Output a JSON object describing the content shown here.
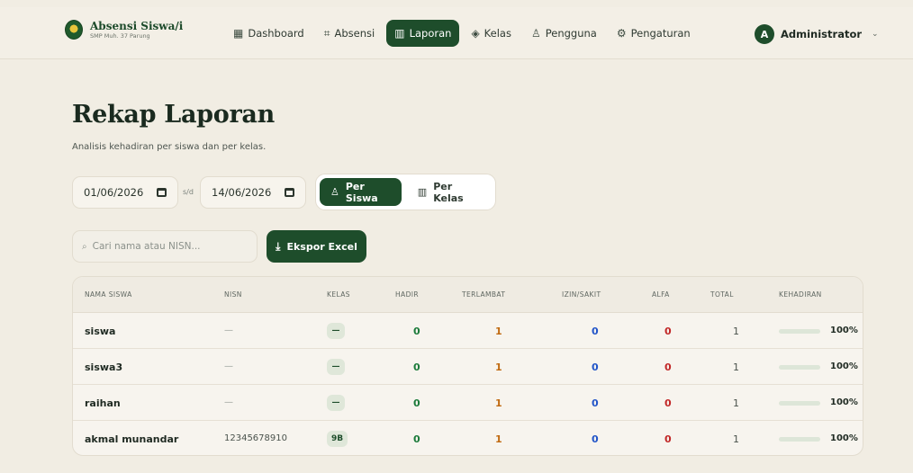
{
  "brand": {
    "title": "Absensi Siswa/i",
    "subtitle": "SMP Muh. 37 Parung"
  },
  "nav": [
    {
      "label": "Dashboard",
      "icon": "grid-icon",
      "glyph": "▦",
      "active": false
    },
    {
      "label": "Absensi",
      "icon": "scan-icon",
      "glyph": "⌗",
      "active": false
    },
    {
      "label": "Laporan",
      "icon": "bar-chart-icon",
      "glyph": "▥",
      "active": true
    },
    {
      "label": "Kelas",
      "icon": "graduation-cap-icon",
      "glyph": "◈",
      "active": false
    },
    {
      "label": "Pengguna",
      "icon": "users-icon",
      "glyph": "♙",
      "active": false
    },
    {
      "label": "Pengaturan",
      "icon": "gear-icon",
      "glyph": "⚙",
      "active": false
    }
  ],
  "user": {
    "initial": "A",
    "name": "Administrator"
  },
  "page": {
    "title": "Rekap Laporan",
    "subtitle": "Analisis kehadiran per siswa dan per kelas."
  },
  "filters": {
    "date_from": "01/06/2026",
    "date_to": "14/06/2026",
    "separator": "s/d",
    "modes": [
      {
        "label": "Per Siswa",
        "icon": "users-icon",
        "glyph": "♙",
        "active": true
      },
      {
        "label": "Per Kelas",
        "icon": "bar-chart-icon",
        "glyph": "▥",
        "active": false
      }
    ],
    "search_placeholder": "Cari nama atau NISN...",
    "export_label": "Ekspor Excel"
  },
  "table": {
    "headers": [
      "NAMA SISWA",
      "NISN",
      "KELAS",
      "HADIR",
      "TERLAMBAT",
      "IZIN/SAKIT",
      "ALFA",
      "TOTAL",
      "KEHADIRAN"
    ],
    "rows": [
      {
        "nama": "siswa",
        "nisn": "—",
        "kelas": "—",
        "hadir": "0",
        "terlambat": "1",
        "izin": "0",
        "alfa": "0",
        "total": "1",
        "kehadiran": "100%",
        "kehadiran_value": 100
      },
      {
        "nama": "siswa3",
        "nisn": "—",
        "kelas": "—",
        "hadir": "0",
        "terlambat": "1",
        "izin": "0",
        "alfa": "0",
        "total": "1",
        "kehadiran": "100%",
        "kehadiran_value": 100
      },
      {
        "nama": "raihan",
        "nisn": "—",
        "kelas": "—",
        "hadir": "0",
        "terlambat": "1",
        "izin": "0",
        "alfa": "0",
        "total": "1",
        "kehadiran": "100%",
        "kehadiran_value": 100
      },
      {
        "nama": "akmal munandar",
        "nisn": "12345678910",
        "kelas": "9B",
        "hadir": "0",
        "terlambat": "1",
        "izin": "0",
        "alfa": "0",
        "total": "1",
        "kehadiran": "100%",
        "kehadiran_value": 100
      }
    ]
  },
  "colors": {
    "brand_green": "#1e4d2b",
    "hadir": "#1b7a3a",
    "terlambat": "#c06a11",
    "izin": "#2154c8",
    "alfa": "#c12727",
    "progress": "#2fb45a"
  }
}
